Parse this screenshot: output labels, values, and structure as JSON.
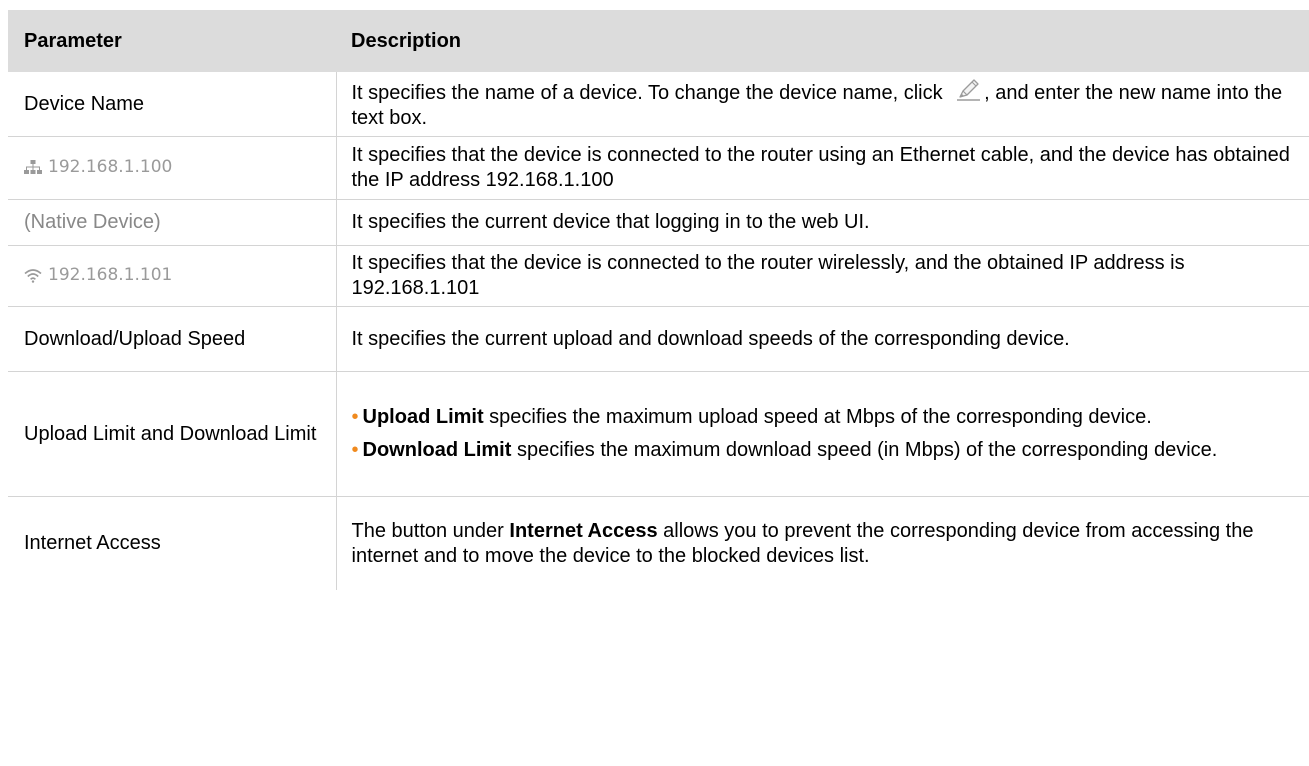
{
  "header": {
    "parameter": "Parameter",
    "description": "Description"
  },
  "rows": {
    "device_name": {
      "param": "Device Name",
      "desc_before_icon": "It specifies the name of a device. To change the device name, click ",
      "desc_after_icon": ", and enter the new name into the text box."
    },
    "wired": {
      "param_ip": "192.168.1.100",
      "param_icon": "ethernet-icon",
      "desc": "It specifies that the device is connected to the router using an Ethernet cable, and the device has obtained the IP address 192.168.1.100"
    },
    "native": {
      "param": "(Native Device)",
      "desc": "It specifies the current device that logging in to the web UI."
    },
    "wireless": {
      "param_ip": "192.168.1.101",
      "param_icon": "wifi-icon",
      "desc": "It specifies that the device is connected to the router wirelessly, and the obtained IP address is 192.168.1.101"
    },
    "speed": {
      "param": "Download/Upload Speed",
      "desc": "It specifies the current upload and download speeds of the corresponding device."
    },
    "limit": {
      "param": "Upload Limit and Download Limit",
      "bullet1_bold": "Upload Limit",
      "bullet1_rest": " specifies the maximum upload speed at Mbps of the corresponding device.",
      "bullet2_bold": "Download Limit",
      "bullet2_rest": " specifies the maximum download speed (in Mbps) of the corresponding device."
    },
    "internet": {
      "param": "Internet Access",
      "desc_before": "The button under ",
      "desc_bold": "Internet Access",
      "desc_after": " allows you to prevent the corresponding device from accessing the internet and to move the device to the blocked devices list."
    }
  },
  "colors": {
    "header_bg": "#dcdcdc",
    "bullet": "#f08a1e",
    "sample_text": "#9a9a9a",
    "border": "#d4d4d4"
  }
}
